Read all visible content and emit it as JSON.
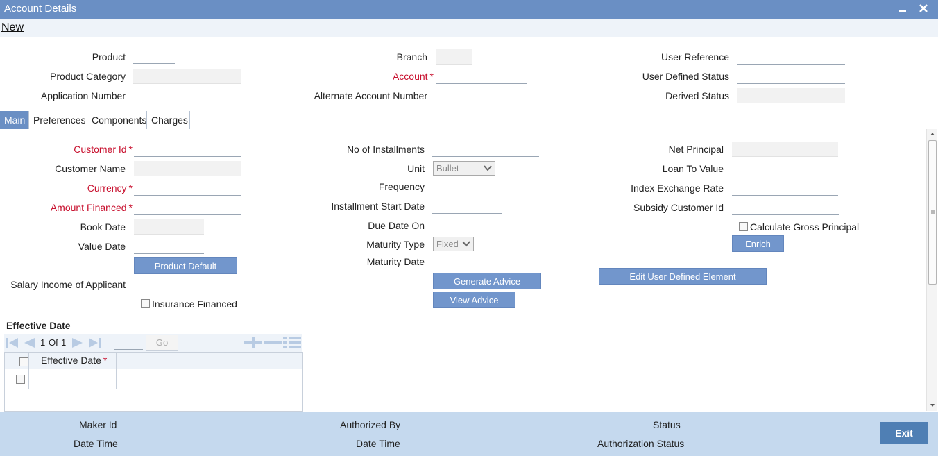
{
  "window": {
    "title": "Account Details"
  },
  "toolbar": {
    "new_label": "New"
  },
  "header": {
    "product_label": "Product",
    "product_category_label": "Product Category",
    "application_number_label": "Application Number",
    "branch_label": "Branch",
    "account_label": "Account",
    "alternate_account_label": "Alternate Account Number",
    "user_reference_label": "User Reference",
    "user_defined_status_label": "User Defined Status",
    "derived_status_label": "Derived Status",
    "required_marker": "*"
  },
  "tabs": [
    {
      "label": "Main"
    },
    {
      "label": "Preferences"
    },
    {
      "label": "Components"
    },
    {
      "label": "Charges"
    }
  ],
  "main": {
    "left": {
      "customer_id_label": "Customer Id",
      "customer_name_label": "Customer Name",
      "currency_label": "Currency",
      "amount_financed_label": "Amount Financed",
      "book_date_label": "Book Date",
      "value_date_label": "Value Date",
      "product_default_button": "Product Default",
      "salary_income_label": "Salary Income of Applicant",
      "insurance_financed_label": "Insurance Financed"
    },
    "middle": {
      "no_of_installments_label": "No of Installments",
      "unit_label": "Unit",
      "unit_value": "Bullet",
      "frequency_label": "Frequency",
      "installment_start_date_label": "Installment Start Date",
      "due_date_on_label": "Due Date On",
      "maturity_type_label": "Maturity Type",
      "maturity_type_value": "Fixed",
      "maturity_date_label": "Maturity Date",
      "generate_advice_button": "Generate Advice",
      "view_advice_button": "View Advice"
    },
    "right": {
      "net_principal_label": "Net Principal",
      "loan_to_value_label": "Loan To Value",
      "index_exchange_rate_label": "Index Exchange Rate",
      "subsidy_customer_id_label": "Subsidy Customer Id",
      "calculate_gross_principal_label": "Calculate Gross Principal",
      "enrich_button": "Enrich",
      "edit_udf_button": "Edit User Defined Element"
    }
  },
  "effective_date": {
    "section_title": "Effective Date",
    "pager": {
      "current": "1",
      "of_label": "Of",
      "total": "1"
    },
    "go_button": "Go",
    "column_header": "Effective Date"
  },
  "footer": {
    "maker_id_label": "Maker Id",
    "date_time_label_1": "Date Time",
    "authorized_by_label": "Authorized By",
    "date_time_label_2": "Date Time",
    "status_label": "Status",
    "authorization_status_label": "Authorization Status",
    "exit_button": "Exit"
  },
  "colors": {
    "title_bar": "#6a8fc4",
    "button": "#7296cc",
    "required": "#c8102e",
    "footer": "#c5d9ee",
    "exit_button": "#4f7fb4"
  }
}
